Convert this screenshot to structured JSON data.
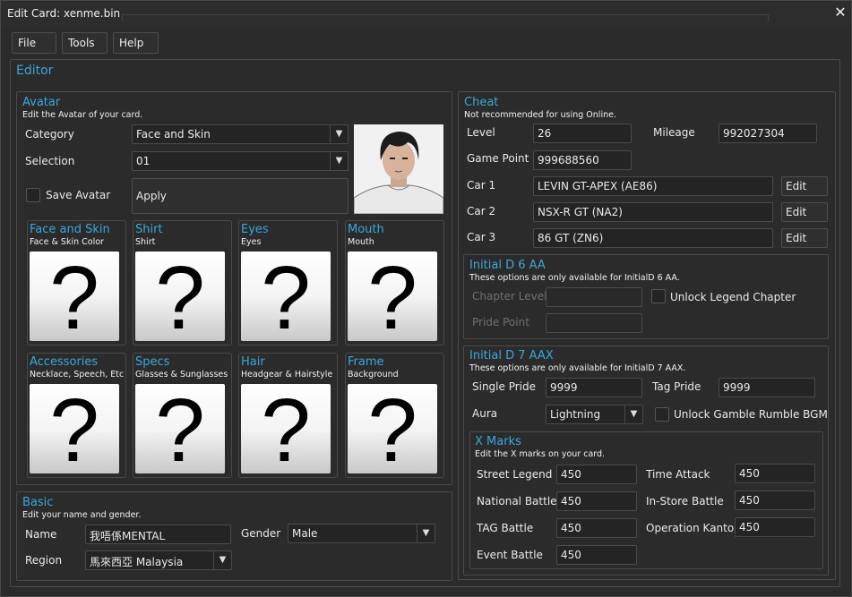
{
  "window": {
    "title": "Edit Card: xenme.bin",
    "close_glyph": "✕"
  },
  "menu": {
    "file": "File",
    "tools": "Tools",
    "help": "Help"
  },
  "editor": {
    "title": "Editor"
  },
  "avatar": {
    "title": "Avatar",
    "subtitle": "Edit the Avatar of your card.",
    "category_label": "Category",
    "category_value": "Face and Skin",
    "selection_label": "Selection",
    "selection_value": "01",
    "save_label": "Save Avatar",
    "apply_label": "Apply",
    "tiles": [
      {
        "name": "Face and Skin",
        "sub": "Face & Skin Color"
      },
      {
        "name": "Shirt",
        "sub": "Shirt"
      },
      {
        "name": "Eyes",
        "sub": "Eyes"
      },
      {
        "name": "Mouth",
        "sub": "Mouth"
      },
      {
        "name": "Accessories",
        "sub": "Necklace, Speech, Etc"
      },
      {
        "name": "Specs",
        "sub": "Glasses & Sunglasses"
      },
      {
        "name": "Hair",
        "sub": "Headgear & Hairstyle"
      },
      {
        "name": "Frame",
        "sub": "Background"
      }
    ],
    "placeholder_glyph": "?"
  },
  "basic": {
    "title": "Basic",
    "subtitle": "Edit your name and gender.",
    "name_label": "Name",
    "name_value": "我唔係MENTAL",
    "gender_label": "Gender",
    "gender_value": "Male",
    "region_label": "Region",
    "region_value": "馬來西亞 Malaysia"
  },
  "cheat": {
    "title": "Cheat",
    "subtitle": "Not recommended for using Online.",
    "level_label": "Level",
    "level_value": "26",
    "mileage_label": "Mileage",
    "mileage_value": "992027304",
    "gamepoint_label": "Game Point",
    "gamepoint_value": "999688560",
    "cars": [
      {
        "label": "Car 1",
        "value": "LEVIN GT-APEX (AE86)",
        "edit": "Edit"
      },
      {
        "label": "Car 2",
        "value": "NSX-R GT (NA2)",
        "edit": "Edit"
      },
      {
        "label": "Car 3",
        "value": "86 GT (ZN6)",
        "edit": "Edit"
      }
    ]
  },
  "id6": {
    "title": "Initial D 6 AA",
    "subtitle": "These options are only available for InitialD 6 AA.",
    "chapter_label": "Chapter Level",
    "unlock_label": "Unlock Legend Chapter",
    "pride_label": "Pride Point"
  },
  "id7": {
    "title": "Initial D 7 AAX",
    "subtitle": "These options are only available for InitialD 7 AAX.",
    "single_label": "Single Pride",
    "single_value": "9999",
    "tag_label": "Tag Pride",
    "tag_value": "9999",
    "aura_label": "Aura",
    "aura_value": "Lightning",
    "unlock_label": "Unlock Gamble Rumble BGM"
  },
  "xmarks": {
    "title": "X Marks",
    "subtitle": "Edit the X marks on your card.",
    "left": [
      {
        "label": "Street Legend",
        "value": "450"
      },
      {
        "label": "National Battle",
        "value": "450"
      },
      {
        "label": "TAG Battle",
        "value": "450"
      },
      {
        "label": "Event Battle",
        "value": "450"
      }
    ],
    "right": [
      {
        "label": "Time Attack",
        "value": "450"
      },
      {
        "label": "In-Store Battle",
        "value": "450"
      },
      {
        "label": "Operation Kanto",
        "value": "450"
      }
    ]
  }
}
